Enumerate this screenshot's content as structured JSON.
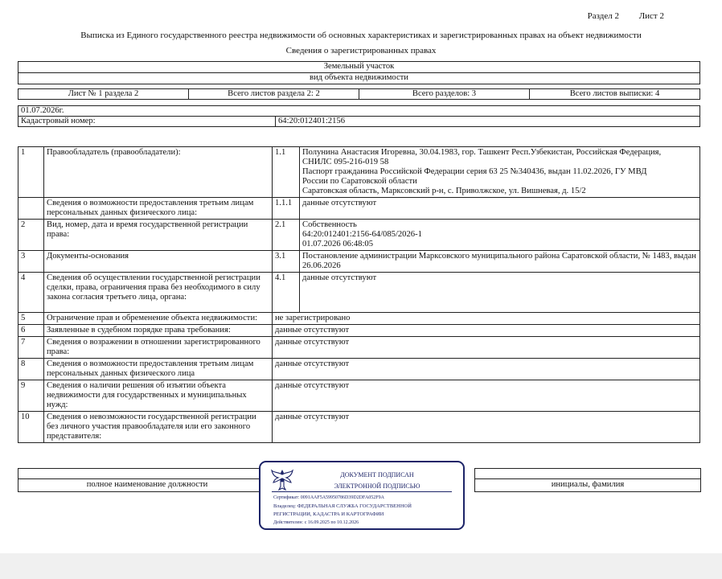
{
  "header": {
    "section": "Раздел 2",
    "sheet": "Лист 2",
    "title": "Выписка из Единого государственного реестра недвижимости об основных характеристиках и зарегистрированных правах на объект недвижимости",
    "subtitle": "Сведения о зарегистрированных правах"
  },
  "object": {
    "type": "Земельный участок",
    "type_caption": "вид объекта недвижимости"
  },
  "sheets": {
    "sheet_of_section": "Лист № 1 раздела 2",
    "total_section_sheets": "Всего листов раздела 2: 2",
    "total_sections": "Всего разделов: 3",
    "total_extract_sheets": "Всего листов выписки: 4"
  },
  "meta": {
    "date": "01.07.2026г.",
    "cadastral_label": "Кадастровый номер:",
    "cadastral_value": "64:20:012401:2156"
  },
  "rows": {
    "r1": {
      "num": "1",
      "label": "Правообладатель (правообладатели):",
      "subnum": "1.1",
      "line1": "Полунина Анастасия Игоревна, 30.04.1983, гор. Ташкент Респ.Узбекистан, Российская Федерация,",
      "line2": "СНИЛС 095-216-019 58",
      "line3": "Паспорт гражданина Российской Федерации серия 63 25 №340436, выдан 11.02.2026, ГУ МВД",
      "line4": "России по Саратовской области",
      "line5": "Саратовская область, Марксовский р-н, с. Приволжское, ул. Вишневая, д. 15/2"
    },
    "r1a": {
      "label": "Сведения о возможности предоставления третьим лицам персональных данных физического лица:",
      "subnum": "1.1.1",
      "value": "данные отсутствуют"
    },
    "r2": {
      "num": "2",
      "label": "Вид, номер, дата и время государственной регистрации права:",
      "subnum": "2.1",
      "line1": "Собственность",
      "line2": "64:20:012401:2156-64/085/2026-1",
      "line3": "01.07.2026 06:48:05"
    },
    "r3": {
      "num": "3",
      "label": "Документы-основания",
      "subnum": "3.1",
      "value": "Постановление администрации Марксовского муниципального района Саратовской области, № 1483, выдан 26.06.2026"
    },
    "r4": {
      "num": "4",
      "label": "Сведения об осуществлении государственной регистрации сделки, права, ограничения права без необходимого в силу закона согласия третьего лица, органа:",
      "subnum": "4.1",
      "value": "данные отсутствуют"
    },
    "r5": {
      "num": "5",
      "label": "Ограничение прав и обременение объекта недвижимости:",
      "value": "не зарегистрировано"
    },
    "r6": {
      "num": "6",
      "label": "Заявленные в судебном порядке права требования:",
      "value": "данные отсутствуют"
    },
    "r7": {
      "num": "7",
      "label": "Сведения о возражении в отношении зарегистрированного права:",
      "value": "данные отсутствуют"
    },
    "r8": {
      "num": "8",
      "label": "Сведения о возможности предоставления третьим лицам персональных данных физического лица",
      "value": "данные отсутствуют"
    },
    "r9": {
      "num": "9",
      "label": "Сведения о наличии решения об изъятии объекта недвижимости для государственных и муниципальных нужд:",
      "value": "данные отсутствуют"
    },
    "r10": {
      "num": "10",
      "label": "Сведения о невозможности государственной регистрации без личного участия правообладателя или его законного представителя:",
      "value": "данные отсутствуют"
    }
  },
  "signature": {
    "position_caption": "полное наименование должности",
    "name_caption": "инициалы, фамилия",
    "stamp": {
      "title1": "ДОКУМЕНТ ПОДПИСАН",
      "title2": "ЭЛЕКТРОННОЙ ПОДПИСЬЮ",
      "certificate": "Сертификат: 0091AAF5A59950786D39D2DFA052F9A",
      "owner1": "Владелец: ФЕДЕРАЛЬНАЯ СЛУЖБА ГОСУДАРСТВЕННОЙ",
      "owner2": "РЕГИСТРАЦИИ, КАДАСТРА И КАРТОГРАФИИ",
      "validity": "Действителен: с 16.09.2025 по 10.12.2026"
    }
  }
}
